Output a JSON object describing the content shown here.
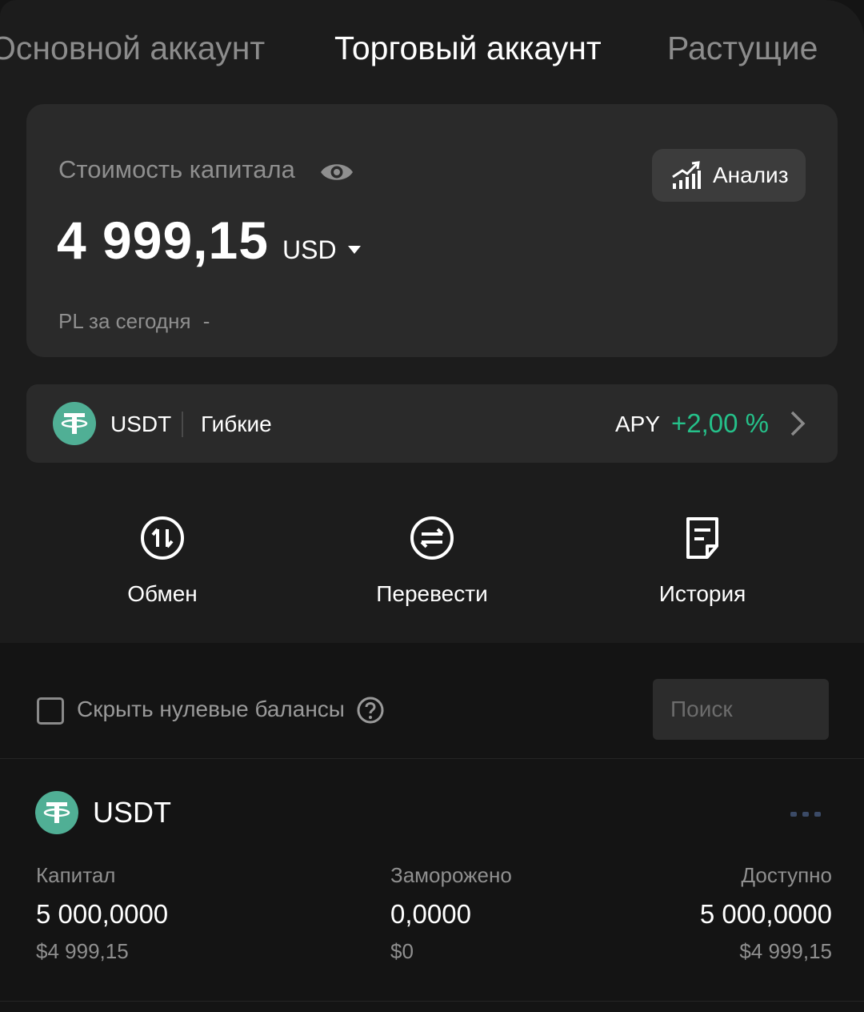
{
  "tabs": [
    {
      "label": "Основной аккаунт"
    },
    {
      "label": "Торговый аккаунт"
    },
    {
      "label": "Растущие"
    }
  ],
  "capital_card": {
    "label": "Стоимость капитала",
    "value": "4 999,15",
    "currency": "USD",
    "pl_label": "PL за сегодня",
    "pl_value": "-",
    "analysis_label": "Анализ"
  },
  "earn_banner": {
    "coin": "USDT",
    "type": "Гибкие",
    "apy_label": "APY",
    "apy_value": "+2,00 %"
  },
  "actions": [
    {
      "label": "Обмен",
      "icon": "exchange-icon"
    },
    {
      "label": "Перевести",
      "icon": "transfer-icon"
    },
    {
      "label": "История",
      "icon": "history-icon"
    }
  ],
  "filter": {
    "hide_zero_label": "Скрыть нулевые балансы",
    "search_placeholder": "Поиск"
  },
  "asset": {
    "name": "USDT",
    "columns": [
      {
        "header": "Капитал",
        "value": "5 000,0000",
        "fiat": "$4 999,15"
      },
      {
        "header": "Заморожено",
        "value": "0,0000",
        "fiat": "$0"
      },
      {
        "header": "Доступно",
        "value": "5 000,0000",
        "fiat": "$4 999,15"
      }
    ]
  },
  "colors": {
    "positive": "#25c18a",
    "tether": "#50af95",
    "background": "#141414",
    "card": "#2a2a2a"
  }
}
